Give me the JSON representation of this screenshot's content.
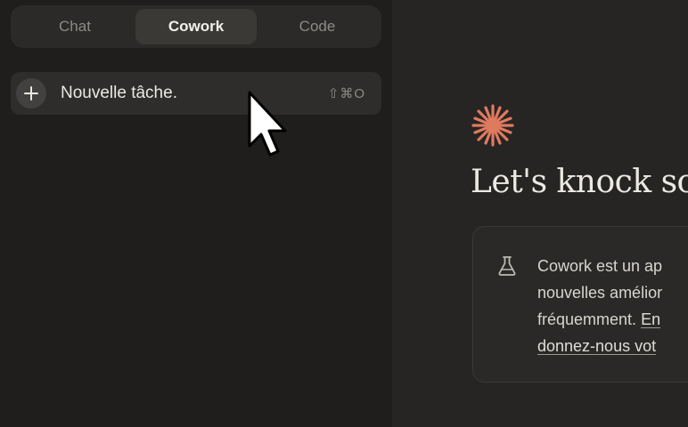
{
  "tabs": [
    {
      "label": "Chat",
      "active": false
    },
    {
      "label": "Cowork",
      "active": true
    },
    {
      "label": "Code",
      "active": false
    }
  ],
  "new_task": {
    "label": "Nouvelle tâche.",
    "shortcut": "⇧⌘O",
    "icon": "plus-icon"
  },
  "main": {
    "logo_icon": "sparkle-logo-icon",
    "logo_color": "#e07a5f",
    "headline": "Let's knock so",
    "notice": {
      "icon": "flask-icon",
      "line1": "Cowork est un ap",
      "line2": "nouvelles amélior",
      "line3_text": "fréquemment. ",
      "line3_link": "En",
      "line4_link": "donnez-nous vot"
    }
  },
  "colors": {
    "background": "#1f1e1d",
    "accent": "#e07a5f",
    "text": "#ece9e3"
  }
}
